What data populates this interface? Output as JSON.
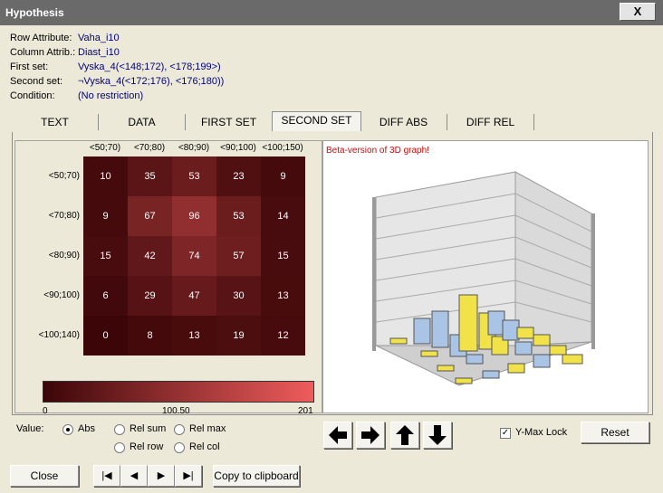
{
  "window": {
    "title": "Hypothesis",
    "close_label": "X"
  },
  "info": [
    {
      "label": "Row Attribute:",
      "value": "Vaha_i10"
    },
    {
      "label": "Column Attrib.:",
      "value": "Diast_i10"
    },
    {
      "label": "First set:",
      "value": "Vyska_4(<148;172), <178;199>)"
    },
    {
      "label": "Second set:",
      "value": "¬Vyska_4(<172;176), <176;180))"
    },
    {
      "label": "Condition:",
      "value": "(No restriction)"
    }
  ],
  "tabs": [
    "TEXT",
    "DATA",
    "FIRST SET",
    "SECOND SET",
    "DIFF ABS",
    "DIFF REL"
  ],
  "active_tab": "SECOND SET",
  "heatmap": {
    "columns": [
      "<50;70)",
      "<70;80)",
      "<80;90)",
      "<90;100)",
      "<100;150)"
    ],
    "rows": [
      "<50;70)",
      "<70;80)",
      "<80;90)",
      "<90;100)",
      "<100;140)"
    ],
    "values": [
      [
        10,
        35,
        53,
        23,
        9
      ],
      [
        9,
        67,
        96,
        53,
        14
      ],
      [
        15,
        42,
        74,
        57,
        15
      ],
      [
        6,
        29,
        47,
        30,
        13
      ],
      [
        0,
        8,
        13,
        19,
        12
      ]
    ],
    "scale_min_label": "0",
    "scale_mid_label": "100.50",
    "scale_max_label": "201",
    "color_low": "#3c0608",
    "color_high": "#ef5c5c"
  },
  "graph3d": {
    "note": "Beta-version of 3D graph!",
    "note_color": "#e00000"
  },
  "value_options": {
    "label": "Value:",
    "options": [
      "Abs",
      "Rel sum",
      "Rel max",
      "Rel row",
      "Rel col"
    ],
    "selected": "Abs"
  },
  "arrows": [
    "arrow-left-icon",
    "arrow-right-icon",
    "arrow-up-icon",
    "arrow-down-icon"
  ],
  "ymax_lock": {
    "label": "Y-Max Lock",
    "checked": true
  },
  "buttons": {
    "reset": "Reset",
    "close": "Close",
    "copy": "Copy to clipboard"
  },
  "nav": [
    "first-record-icon",
    "prev-record-icon",
    "next-record-icon",
    "last-record-icon"
  ]
}
